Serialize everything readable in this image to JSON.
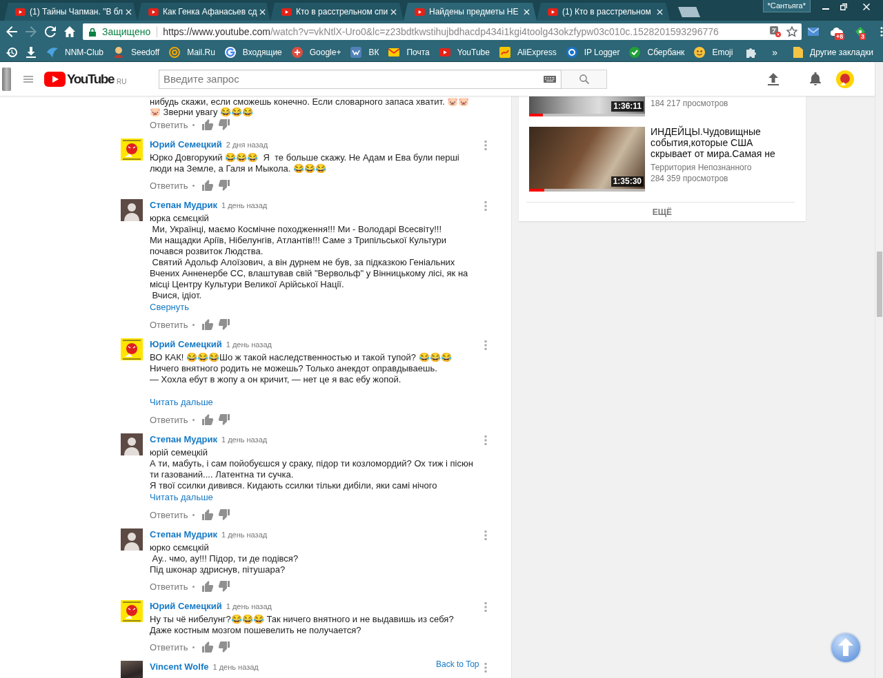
{
  "browser": {
    "tabs": [
      {
        "title": "(1) Тайны Чапман. \"В бл",
        "selected": false
      },
      {
        "title": "Как Генка Афанасьев сд",
        "selected": false
      },
      {
        "title": "Кто в расстрельном спи",
        "selected": false
      },
      {
        "title": "Найдены предметы НЕ",
        "selected": true
      },
      {
        "title": "(1) Кто в расстрельном",
        "selected": false
      }
    ],
    "profile": "*Сантьяга*",
    "omnibox": {
      "security": "Защищено",
      "url_origin": "https://www.youtube.com",
      "url_path": "/watch?v=vkNtlX-Uro0&lc=z23bdtkwstihujbdhacdp434i1kgi4toolg43okzfypw03c010c.1528201593296776"
    },
    "extension_badges": [
      "+8",
      "3"
    ],
    "bookmarks": [
      "NNM-Club",
      "Seedoff",
      "Mail.Ru",
      "Входящие",
      "Google+",
      "ВК",
      "Почта",
      "YouTube",
      "AliExpress",
      "IP Logger",
      "Сбербанк",
      "Emoji"
    ],
    "overflow": "»",
    "other_bookmarks": "Другие закладки"
  },
  "header": {
    "logo": "YouTube",
    "region": "RU",
    "search_placeholder": "Введите запрос"
  },
  "comments": [
    {
      "text": "нибудь скажи, если сможешь конечно. Если словарного запаса хватит. 🐷🐷\n🐷 Зверни увагу 😂😂😂",
      "reply": "Ответить"
    },
    {
      "author": "Юрий Семецкий",
      "avatar": {
        "kind": "cartoon"
      },
      "time": "2 дня назад",
      "text": "Юрко Довгорукий 😂😂😂  Я  те больше скажу. Не Адам и Ева були перші\nлюди на Земле, а Галя и Мыкола. 😂😂😂",
      "reply": "Ответить"
    },
    {
      "author": "Степан Мудрик",
      "avatar": {
        "kind": "silhouette"
      },
      "time": "1 день назад",
      "text": "юрка сємєцкій\n Ми, Українці, маємо Космічне походження!!! Ми - Володарі Всесвіту!!!\nМи нащадки Аріїв, Нібелунгів, Атлантів!!! Саме з Трипільської Культури\nпочався розвиток Людства.\n Святий Адольф Алоїзович, а він дурнем не був, за підказкою Геніальних\nВчених Анненербе СС, влаштував свій \"Вервольф\" у Вінницькому лісі, як на\nмісці Центру Культури Великої Арійської Нації.\n Вчися, ідіот.",
      "more": "Свернуть",
      "reply": "Ответить"
    },
    {
      "author": "Юрий Семецкий",
      "avatar": {
        "kind": "cartoon"
      },
      "time": "1 день назад",
      "text": "ВО КАК! 😂😂😂Шо ж такой наследственностью и такой тупой? 😂😂😂\nНичего внятного родить не можешь? Только анекдот оправдываешь.\n— Хохла ебут в жопу а он кричит, — нет це я вас ебу жопой.\n\n",
      "more": "Читать дальше",
      "reply": "Ответить"
    },
    {
      "author": "Степан Мудрик",
      "avatar": {
        "kind": "silhouette"
      },
      "time": "1 день назад",
      "text": "юрій семецкій\nА ти, мабуть, і сам пойобуєшся у сраку, підор ти козломордий? Ох тиж і пісюн\nти газований.... Латентна ти сучка.\nЯ твої ссилки дивився. Кидають ссилки тільки дибіли, яки самі нічого",
      "more": "Читать дальше",
      "reply": "Ответить"
    },
    {
      "author": "Степан Мудрик",
      "avatar": {
        "kind": "silhouette"
      },
      "time": "1 день назад",
      "text": "юрко сємєцкій\n Ау.. чмо, ау!!! Підор, ти де подівся?\nПід шконар здриснув, пітушара?",
      "reply": "Ответить"
    },
    {
      "author": "Юрий Семецкий",
      "avatar": {
        "kind": "cartoon"
      },
      "time": "1 день назад",
      "text": "Ну ты чё нибелунг?😂😂😂 Так ничего внятного и не выдавишь из себя?\nДаже костным мозгом пошевелить не получается?",
      "reply": "Ответить"
    },
    {
      "author": "Vincent Wolfe",
      "avatar": {
        "kind": "photo"
      },
      "time": "1 день назад"
    }
  ],
  "related": [
    {
      "duration": "1:36:11",
      "level": 0.12,
      "views": "184 217 просмотров"
    },
    {
      "title": "ИНДЕЙЦЫ.Чудовищные\nсобытия,которые США\nскрывает от мира.Самая не",
      "channel": "Территория Непознанного",
      "duration": "1:35:30",
      "level": 0.13,
      "views": "284 359 просмотров"
    }
  ],
  "show_more": "ЕЩЁ",
  "back_to_top": "Back to Top"
}
